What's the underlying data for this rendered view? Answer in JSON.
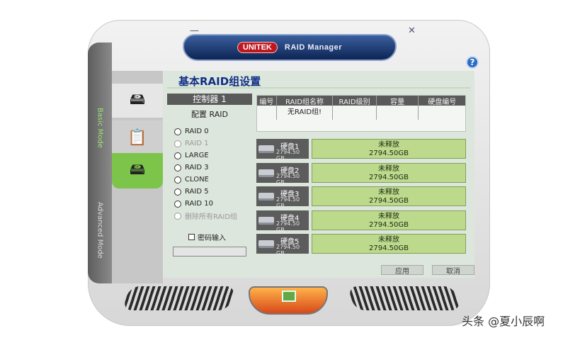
{
  "window": {
    "brand": "UNITEK",
    "title": "RAID Manager",
    "minimize_glyph": "—",
    "close_glyph": "✕",
    "help_glyph": "?"
  },
  "modes": {
    "basic": "Basic Mode",
    "advanced": "Advanced Mode"
  },
  "panel": {
    "title": "基本RAID组设置"
  },
  "controller": {
    "header": "控制器 1",
    "config_label": "配置 RAID",
    "options": [
      {
        "label": "RAID 0",
        "enabled": true
      },
      {
        "label": "RAID 1",
        "enabled": false
      },
      {
        "label": "LARGE",
        "enabled": true
      },
      {
        "label": "RAID 3",
        "enabled": true
      },
      {
        "label": "CLONE",
        "enabled": true
      },
      {
        "label": "RAID 5",
        "enabled": true
      },
      {
        "label": "RAID 10",
        "enabled": true
      },
      {
        "label": "删除所有RAID组",
        "enabled": false
      }
    ],
    "password_label": "密码输入"
  },
  "table": {
    "headers": [
      "编号",
      "RAID组名称",
      "RAID级别",
      "容量",
      "硬盘编号"
    ],
    "empty_text": "无RAID组!"
  },
  "disks": [
    {
      "name": "硬盘1",
      "size": "2794.50 GB",
      "status": "未释放",
      "capacity": "2794.50GB"
    },
    {
      "name": "硬盘2",
      "size": "2794.50 GB",
      "status": "未释放",
      "capacity": "2794.50GB"
    },
    {
      "name": "硬盘3",
      "size": "2794.50 GB",
      "status": "未释放",
      "capacity": "2794.50GB"
    },
    {
      "name": "硬盘4",
      "size": "2794.50 GB",
      "status": "未释放",
      "capacity": "2794.50GB"
    },
    {
      "name": "硬盘5",
      "size": "2794.50 GB",
      "status": "未释放",
      "capacity": "2794.50GB"
    }
  ],
  "actions": {
    "apply": "应用",
    "cancel": "取消"
  },
  "watermark": "头条 @夏小辰啊",
  "colors": {
    "accent_green": "#7cc44a",
    "title_blue": "#0f2f86",
    "brand_red": "#c0161e"
  }
}
